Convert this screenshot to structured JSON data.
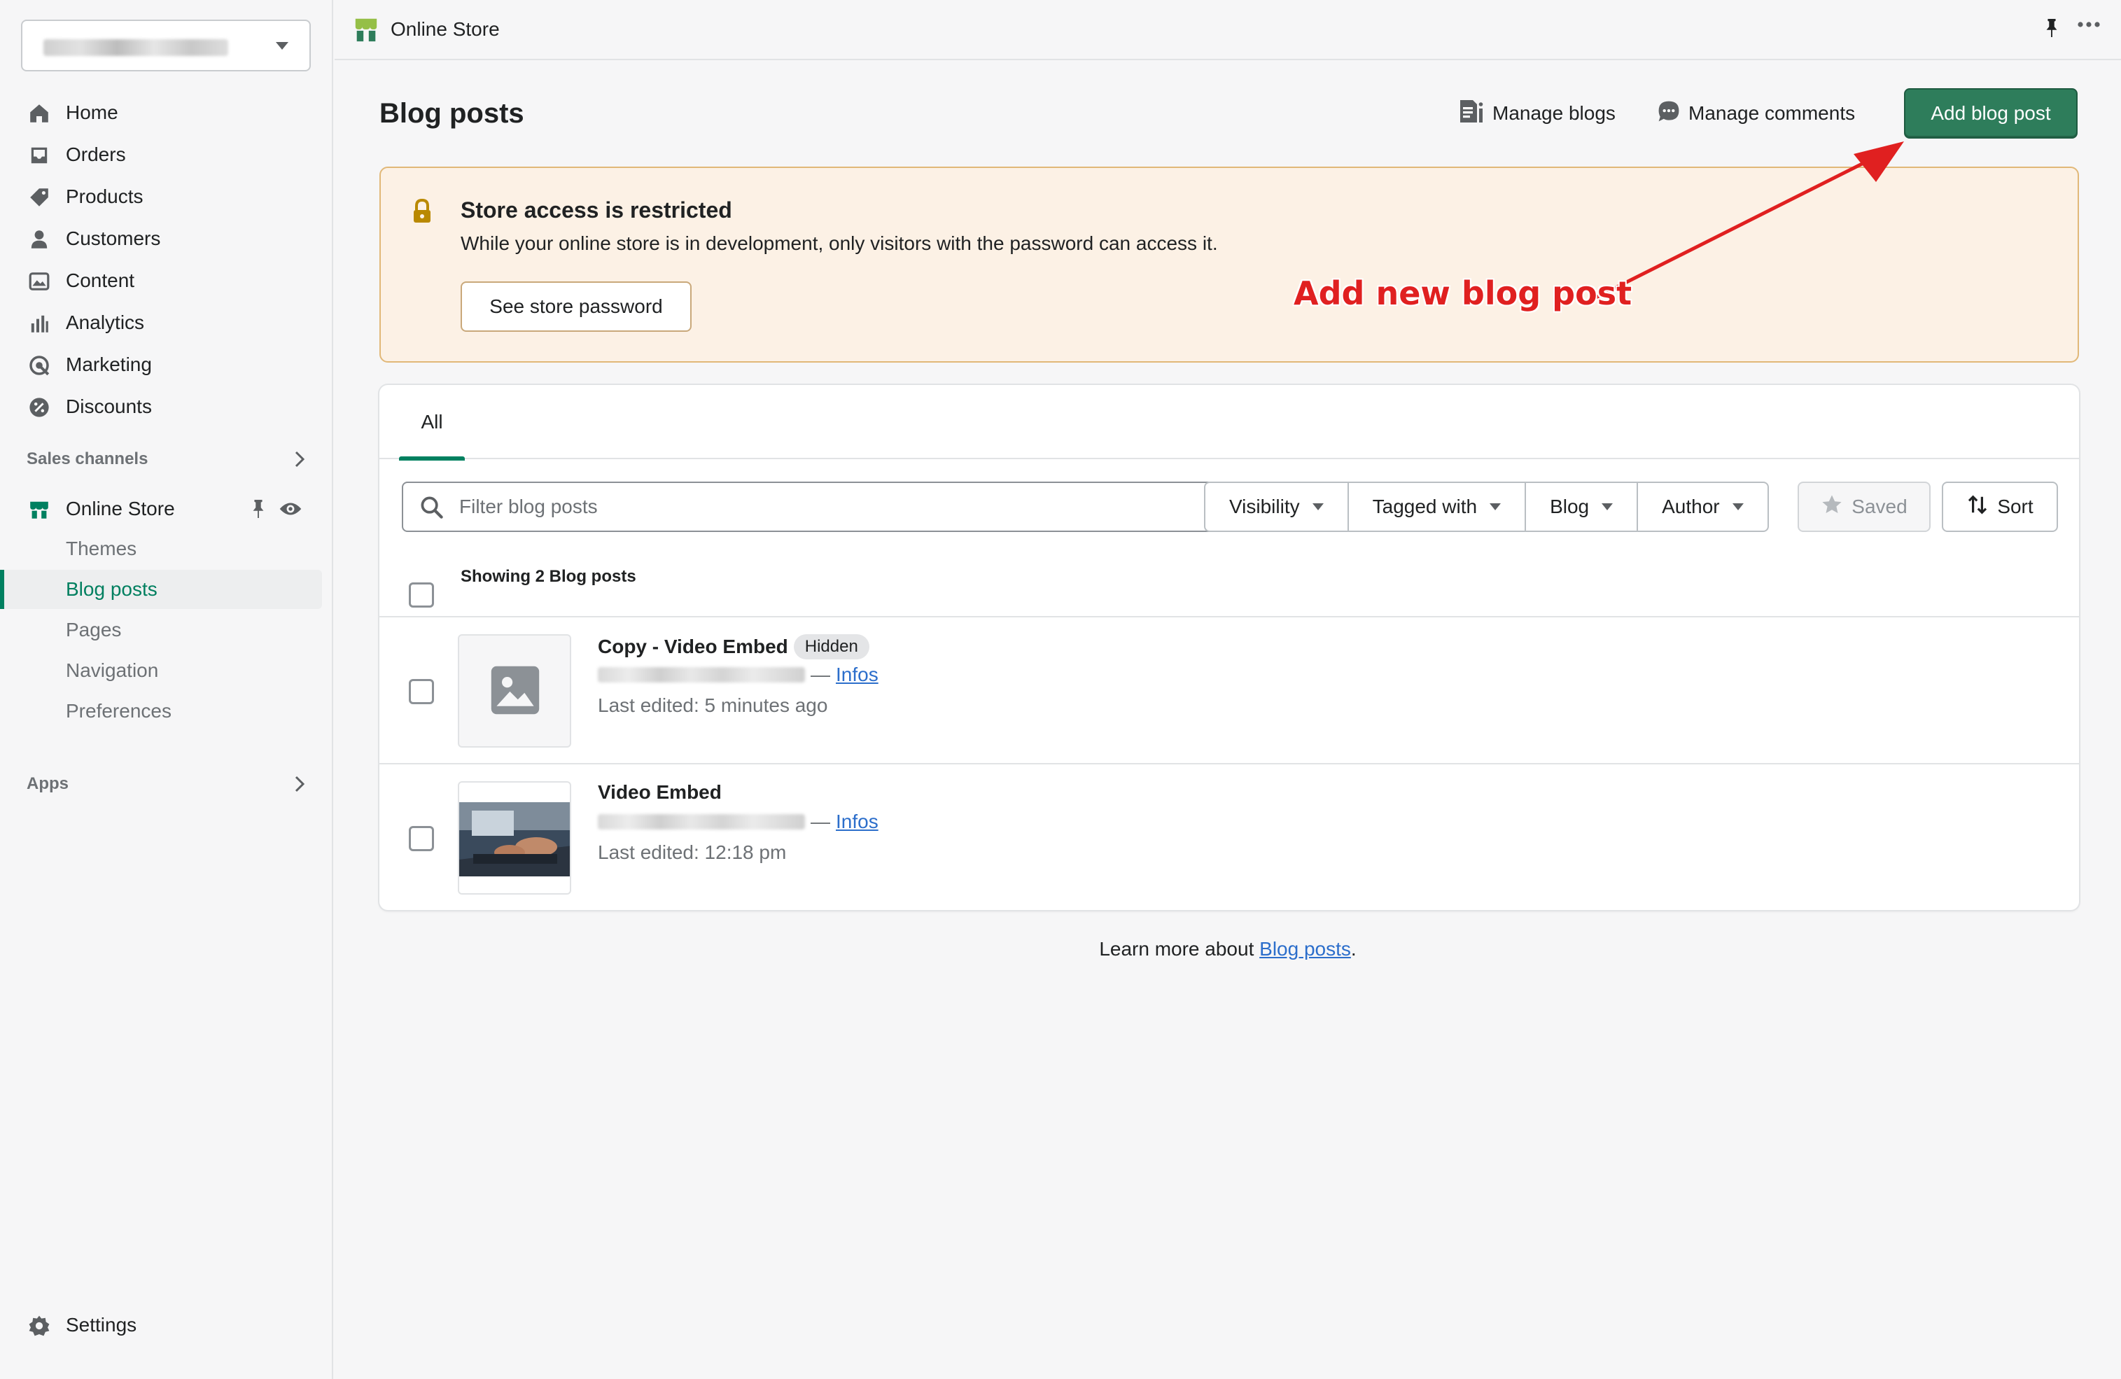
{
  "sidebar": {
    "nav": [
      {
        "label": "Home",
        "icon": "home-icon"
      },
      {
        "label": "Orders",
        "icon": "orders-icon"
      },
      {
        "label": "Products",
        "icon": "tag-icon"
      },
      {
        "label": "Customers",
        "icon": "person-icon"
      },
      {
        "label": "Content",
        "icon": "content-icon"
      },
      {
        "label": "Analytics",
        "icon": "bar-chart-icon"
      },
      {
        "label": "Marketing",
        "icon": "target-icon"
      },
      {
        "label": "Discounts",
        "icon": "discount-icon"
      }
    ],
    "sales_channels_label": "Sales channels",
    "online_store_label": "Online Store",
    "online_store_sub": [
      {
        "label": "Themes"
      },
      {
        "label": "Blog posts",
        "active": true
      },
      {
        "label": "Pages"
      },
      {
        "label": "Navigation"
      },
      {
        "label": "Preferences"
      }
    ],
    "apps_label": "Apps",
    "settings_label": "Settings"
  },
  "topbar": {
    "title": "Online Store"
  },
  "header": {
    "title": "Blog posts",
    "manage_blogs": "Manage blogs",
    "manage_comments": "Manage comments",
    "add_button": "Add blog post"
  },
  "banner": {
    "title": "Store access is restricted",
    "description": "While your online store is in development, only visitors with the password can access it.",
    "button": "See store password"
  },
  "annotation": {
    "text": "Add new blog post",
    "color": "#e02020"
  },
  "list": {
    "tab_all": "All",
    "search_placeholder": "Filter blog posts",
    "filters": [
      "Visibility",
      "Tagged with",
      "Blog",
      "Author"
    ],
    "saved_label": "Saved",
    "sort_label": "Sort",
    "showing": "Showing 2 Blog posts",
    "rows": [
      {
        "title": "Copy - Video Embed",
        "badge": "Hidden",
        "separator": "—",
        "blog_link": "Infos",
        "edited": "Last edited: 5 minutes ago"
      },
      {
        "title": "Video Embed",
        "separator": "—",
        "blog_link": "Infos",
        "edited": "Last edited: 12:18 pm"
      }
    ]
  },
  "footer": {
    "prefix": "Learn more about",
    "link": "Blog posts",
    "suffix": "."
  },
  "colors": {
    "accent": "#008060",
    "primary_button": "#2e7d5b",
    "banner_bg": "#fcf1e5",
    "link": "#2c6ecb"
  }
}
